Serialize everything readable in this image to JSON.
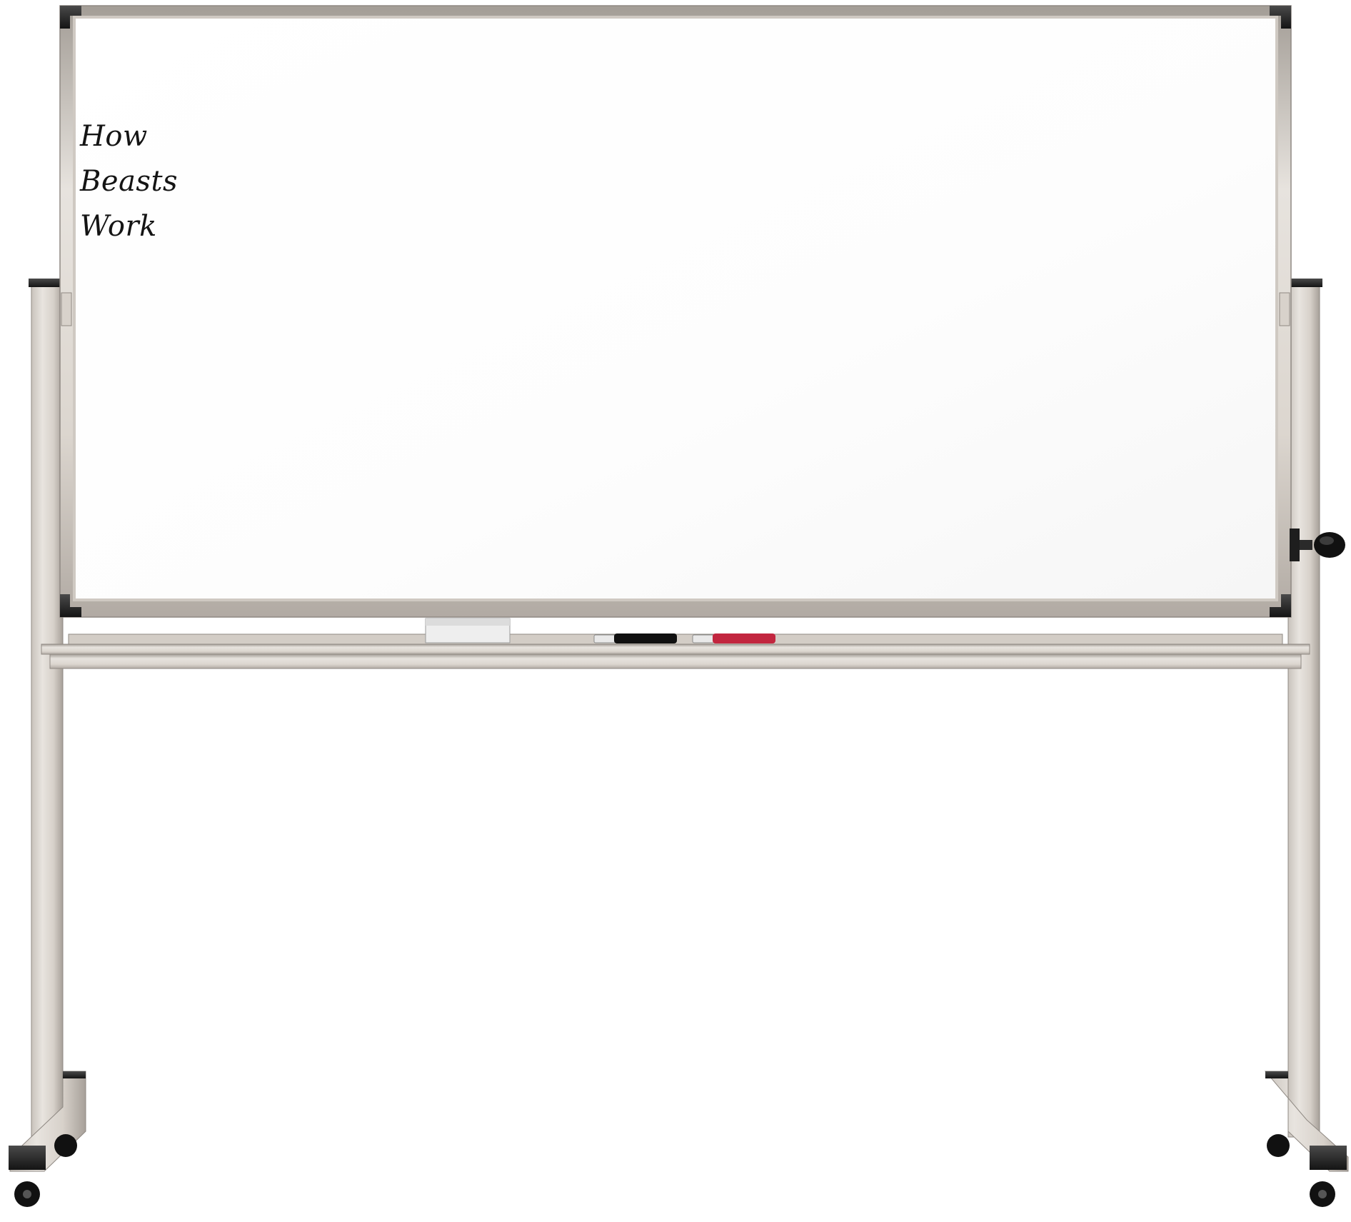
{
  "whiteboard": {
    "handwritten_text": [
      "How",
      "Beasts",
      "Work"
    ]
  },
  "colors": {
    "frame": "#d9d4ce",
    "frame_shadow": "#a9a39c",
    "corner_caps": "#1f1f1f",
    "board_surface": "#ffffff",
    "marker_black": "#111111",
    "marker_red": "#c2263f",
    "eraser": "#eeeeee"
  },
  "objects": {
    "tray_items": [
      "eraser-icon",
      "black-marker-icon",
      "red-marker-icon"
    ],
    "stand": "mobile-stand-with-casters",
    "tension_knob": "knob-icon"
  }
}
